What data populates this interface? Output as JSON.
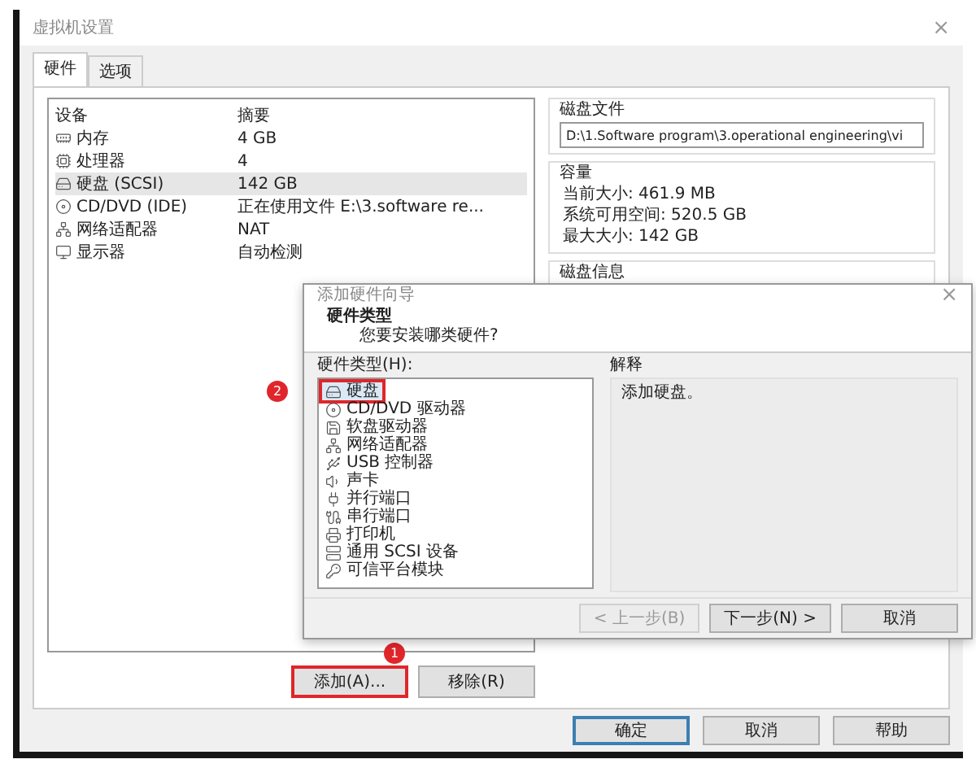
{
  "window": {
    "title": "虚拟机设置",
    "close": "×"
  },
  "tabs": [
    {
      "label": "硬件",
      "selected": true
    },
    {
      "label": "选项",
      "selected": false
    }
  ],
  "device_list": {
    "columns": [
      "设备",
      "摘要"
    ],
    "rows": [
      {
        "kind": "memory",
        "device": "内存",
        "summary": "4 GB",
        "selected": false
      },
      {
        "kind": "cpu",
        "device": "处理器",
        "summary": "4",
        "selected": false
      },
      {
        "kind": "harddisk",
        "device": "硬盘 (SCSI)",
        "summary": "142 GB",
        "selected": true
      },
      {
        "kind": "cdrom",
        "device": "CD/DVD (IDE)",
        "summary": "正在使用文件 E:\\3.software re...",
        "selected": false
      },
      {
        "kind": "network",
        "device": "网络适配器",
        "summary": "NAT",
        "selected": false
      },
      {
        "kind": "display",
        "device": "显示器",
        "summary": "自动检测",
        "selected": false
      }
    ]
  },
  "list_buttons": [
    {
      "label": "添加(A)...",
      "annotated": true,
      "badge": "1"
    },
    {
      "label": "移除(R)",
      "annotated": false
    }
  ],
  "disk_file": {
    "title": "磁盘文件",
    "value": "D:\\1.Software program\\3.operational engineering\\vi"
  },
  "capacity": {
    "title": "容量",
    "lines": [
      "当前大小: 461.9 MB",
      "系统可用空间: 520.5 GB",
      "最大大小: 142 GB"
    ]
  },
  "disk_info": {
    "title": "磁盘信息"
  },
  "wizard": {
    "title": "添加硬件向导",
    "close": "×",
    "heading": "硬件类型",
    "subheading": "您要安装哪类硬件?",
    "list_label": "硬件类型(H):",
    "items": [
      {
        "kind": "harddisk",
        "label": "硬盘",
        "selected": true,
        "annotated": true,
        "badge": "2"
      },
      {
        "kind": "cdrom",
        "label": "CD/DVD 驱动器",
        "selected": false,
        "annotated": false
      },
      {
        "kind": "floppy",
        "label": "软盘驱动器",
        "selected": false,
        "annotated": false
      },
      {
        "kind": "network",
        "label": "网络适配器",
        "selected": false,
        "annotated": false
      },
      {
        "kind": "usb",
        "label": "USB 控制器",
        "selected": false,
        "annotated": false
      },
      {
        "kind": "sound",
        "label": "声卡",
        "selected": false,
        "annotated": false
      },
      {
        "kind": "parallel",
        "label": "并行端口",
        "selected": false,
        "annotated": false
      },
      {
        "kind": "serial",
        "label": "串行端口",
        "selected": false,
        "annotated": false
      },
      {
        "kind": "printer",
        "label": "打印机",
        "selected": false,
        "annotated": false
      },
      {
        "kind": "scsi",
        "label": "通用 SCSI 设备",
        "selected": false,
        "annotated": false
      },
      {
        "kind": "tpm",
        "label": "可信平台模块",
        "selected": false,
        "annotated": false
      }
    ],
    "explanation_title": "解释",
    "explanation": "添加硬盘。",
    "buttons": [
      {
        "label": "< 上一步(B)",
        "disabled": true
      },
      {
        "label": "下一步(N) >",
        "disabled": false
      },
      {
        "label": "取消",
        "disabled": false
      }
    ]
  },
  "buttons": [
    {
      "label": "确定",
      "focused": true
    },
    {
      "label": "取消",
      "focused": false
    },
    {
      "label": "帮助",
      "focused": false
    }
  ]
}
